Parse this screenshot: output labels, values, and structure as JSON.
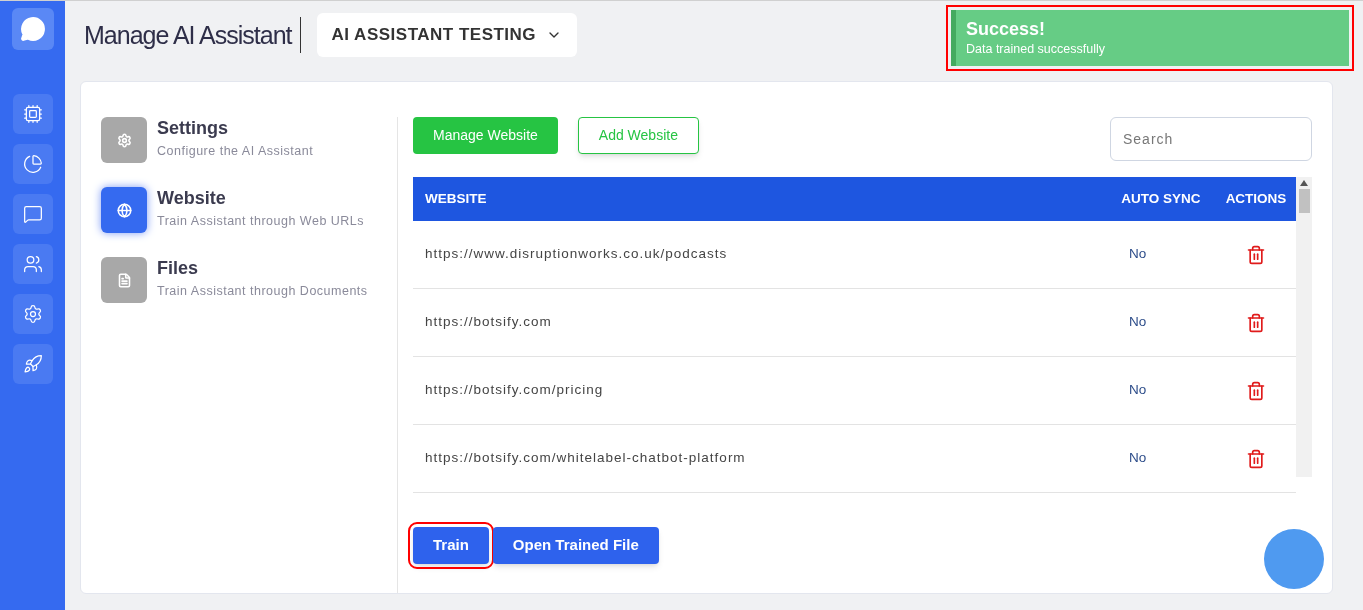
{
  "header": {
    "title": "Manage AI Assistant",
    "assistant_select": "AI ASSISTANT TESTING"
  },
  "toast": {
    "title": "Success!",
    "message": "Data trained successfully",
    "highlighted": true
  },
  "sidebar": {
    "items": [
      {
        "kind": "chip",
        "selected": false
      },
      {
        "kind": "chart",
        "selected": false
      },
      {
        "kind": "chat",
        "selected": false
      },
      {
        "kind": "users",
        "selected": false
      },
      {
        "kind": "settings",
        "selected": false
      },
      {
        "kind": "rocket",
        "selected": false
      }
    ]
  },
  "menu": [
    {
      "kind": "settings",
      "title": "Settings",
      "subtitle": "Configure the AI Assistant",
      "selected": false
    },
    {
      "kind": "website",
      "title": "Website",
      "subtitle": "Train Assistant through Web URLs",
      "selected": true
    },
    {
      "kind": "files",
      "title": "Files",
      "subtitle": "Train Assistant through Documents",
      "selected": false
    }
  ],
  "tabs": [
    {
      "label": "Manage Website",
      "selected": true
    },
    {
      "label": "Add Website",
      "selected": false
    }
  ],
  "search": {
    "placeholder": "Search"
  },
  "table": {
    "columns": [
      "WEBSITE",
      "AUTO SYNC",
      "ACTIONS"
    ],
    "rows": [
      {
        "website": "https://www.disruptionworks.co.uk/podcasts",
        "auto_sync": "No"
      },
      {
        "website": "https://botsify.com",
        "auto_sync": "No"
      },
      {
        "website": "https://botsify.com/pricing",
        "auto_sync": "No"
      },
      {
        "website": "https://botsify.com/whitelabel-chatbot-platform",
        "auto_sync": "No"
      }
    ]
  },
  "buttons": [
    {
      "label": "Train",
      "highlighted": true
    },
    {
      "label": "Open Trained File",
      "highlighted": false
    }
  ]
}
